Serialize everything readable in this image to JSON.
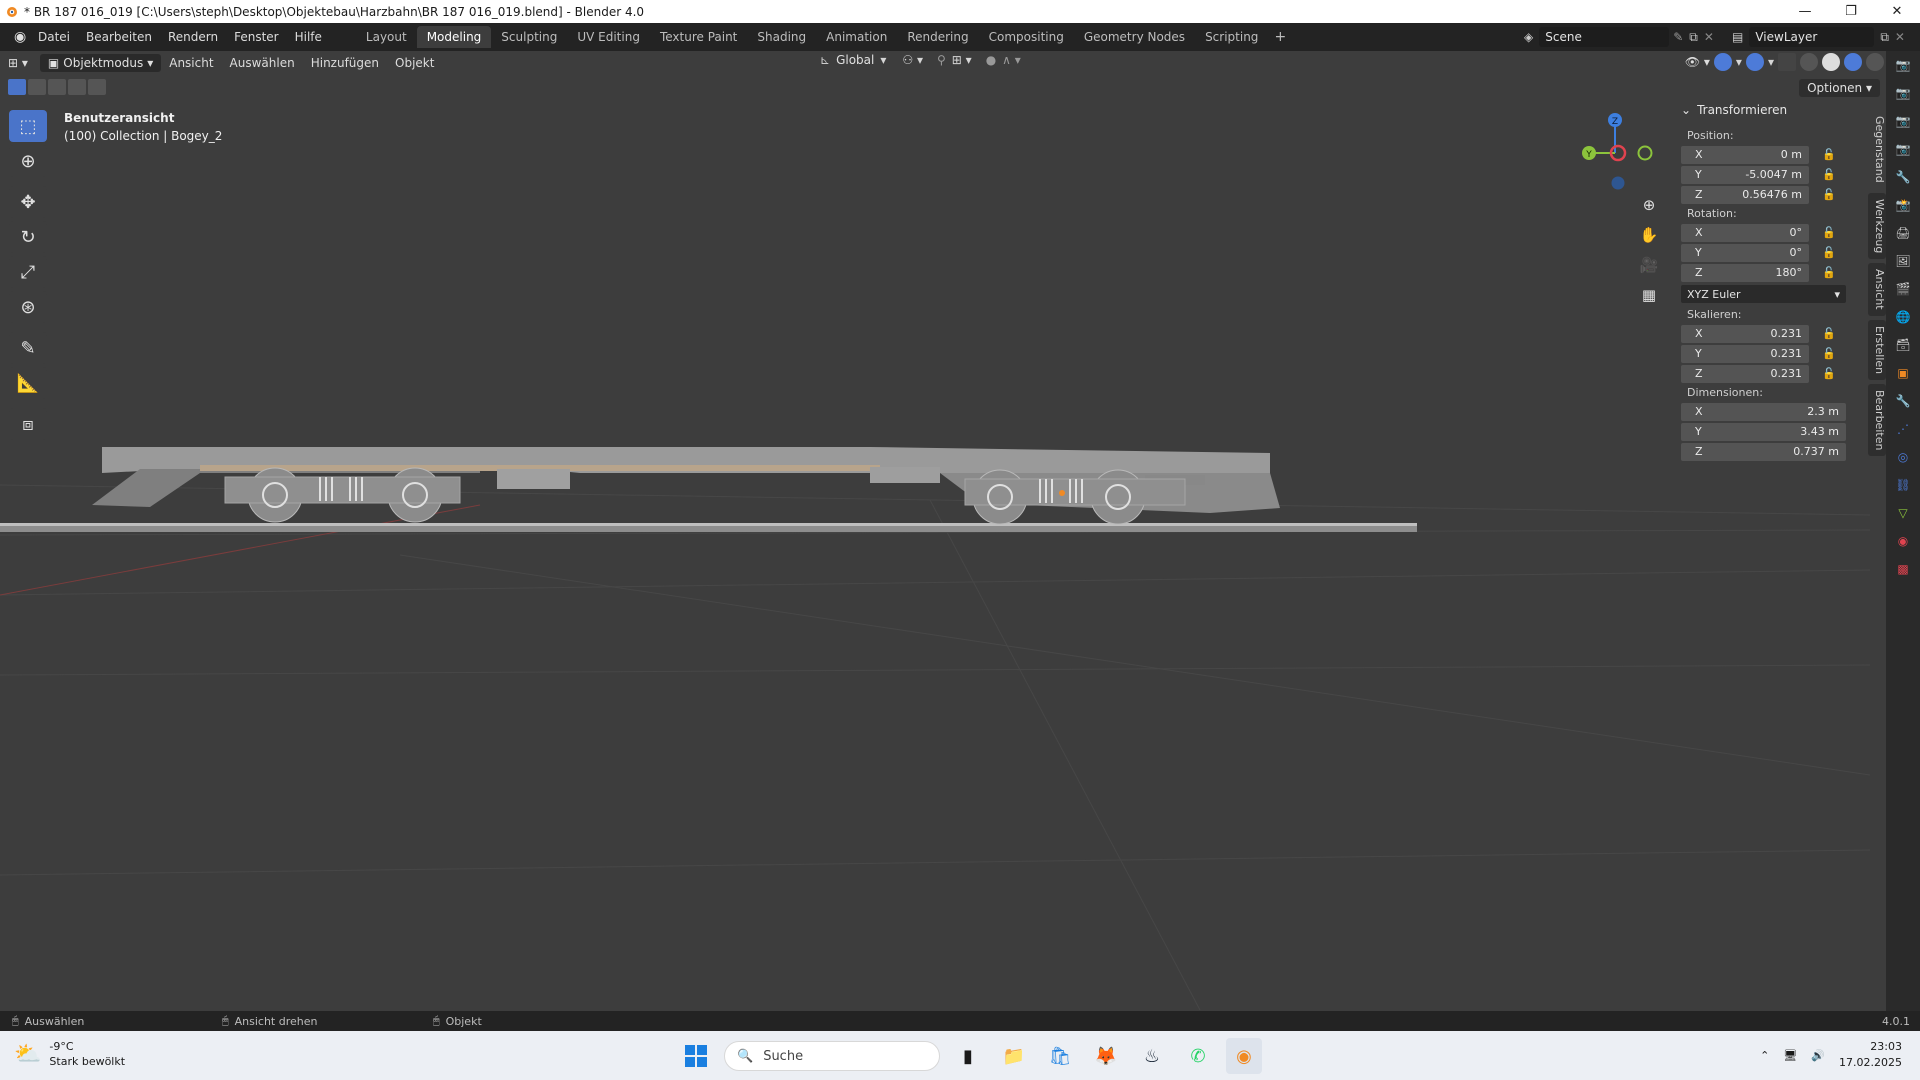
{
  "window": {
    "title": "* BR 187 016_019 [C:\\Users\\steph\\Desktop\\Objektebau\\Harzbahn\\BR 187 016_019.blend] - Blender 4.0",
    "minimize": "—",
    "maximize": "❐",
    "close": "✕"
  },
  "menu": [
    "Datei",
    "Bearbeiten",
    "Rendern",
    "Fenster",
    "Hilfe"
  ],
  "workspaces": [
    "Layout",
    "Modeling",
    "Sculpting",
    "UV Editing",
    "Texture Paint",
    "Shading",
    "Animation",
    "Rendering",
    "Compositing",
    "Geometry Nodes",
    "Scripting"
  ],
  "active_workspace": "Modeling",
  "scene": "Scene",
  "view_layer": "ViewLayer",
  "header": {
    "mode": "Objektmodus",
    "items": [
      "Ansicht",
      "Auswählen",
      "Hinzufügen",
      "Objekt"
    ],
    "orientation": "Global",
    "options": "Optionen"
  },
  "viewport": {
    "view_name": "Benutzeransicht",
    "collection": "(100) Collection | Bogey_2",
    "gizmo_axes": {
      "z": "Z",
      "y": "Y"
    }
  },
  "npanel": {
    "title": "Transformieren",
    "position_label": "Position:",
    "position": [
      {
        "axis": "X",
        "value": "0 m"
      },
      {
        "axis": "Y",
        "value": "-5.0047 m"
      },
      {
        "axis": "Z",
        "value": "0.56476 m"
      }
    ],
    "rotation_label": "Rotation:",
    "rotation": [
      {
        "axis": "X",
        "value": "0°"
      },
      {
        "axis": "Y",
        "value": "0°"
      },
      {
        "axis": "Z",
        "value": "180°"
      }
    ],
    "rotation_mode": "XYZ Euler",
    "scale_label": "Skalieren:",
    "scale": [
      {
        "axis": "X",
        "value": "0.231"
      },
      {
        "axis": "Y",
        "value": "0.231"
      },
      {
        "axis": "Z",
        "value": "0.231"
      }
    ],
    "dimensions_label": "Dimensionen:",
    "dimensions": [
      {
        "axis": "X",
        "value": "2.3 m"
      },
      {
        "axis": "Y",
        "value": "3.43 m"
      },
      {
        "axis": "Z",
        "value": "0.737 m"
      }
    ]
  },
  "sidetabs": [
    "Gegenstand",
    "Werkzeug",
    "Ansicht",
    "Erstellen",
    "Bearbeiten"
  ],
  "statusbar": {
    "select": "Auswählen",
    "rotate": "Ansicht drehen",
    "object": "Objekt",
    "version": "4.0.1"
  },
  "taskbar": {
    "temp": "-9°C",
    "weather": "Stark bewölkt",
    "search": "Suche",
    "time": "23:03",
    "date": "17.02.2025"
  },
  "colors": {
    "accent": "#4a74c9",
    "axis_x": "#e0434f",
    "axis_y": "#8cc43c",
    "axis_z": "#3d7fe0"
  }
}
